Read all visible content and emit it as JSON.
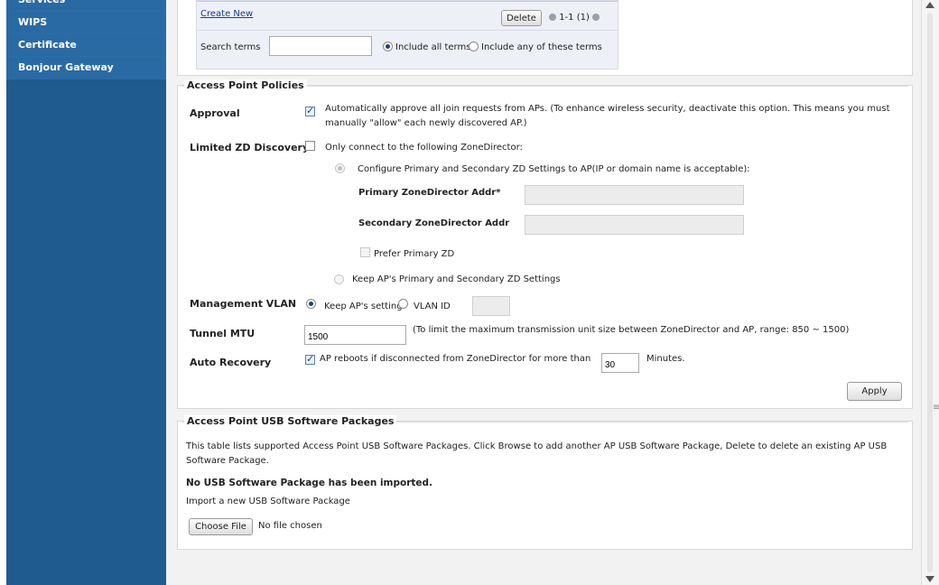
{
  "sidebar": {
    "items": [
      {
        "label": "Services"
      },
      {
        "label": "WIPS"
      },
      {
        "label": "Certificate"
      },
      {
        "label": "Bonjour Gateway"
      }
    ]
  },
  "ap_list": {
    "create_new": "Create New",
    "delete_button": "Delete",
    "pagination": "1-1 (1)",
    "search_label": "Search terms",
    "search_value": "",
    "include_all": "Include all terms",
    "include_any": "Include any of these terms"
  },
  "policies": {
    "title": "Access Point Policies",
    "approval_label": "Approval",
    "approval_text_1": "Automatically approve all join requests from APs. (To enhance wireless security, deactivate this option. This means you must",
    "approval_text_2": "manually \"allow\" each newly discovered AP.)",
    "limited_label": "Limited ZD Discovery",
    "limited_text": "Only connect to the following ZoneDirector:",
    "configure_text": "Configure Primary and Secondary ZD Settings to AP(IP or domain name is acceptable):",
    "primary_label": "Primary ZoneDirector Addr*",
    "secondary_label": "Secondary ZoneDirector Addr",
    "prefer_primary": "Prefer Primary ZD",
    "keep_settings": "Keep AP's Primary and Secondary ZD Settings",
    "mgmt_vlan_label": "Management VLAN",
    "keep_ap_setting": "Keep AP's setting",
    "vlan_id": "VLAN ID",
    "tunnel_mtu_label": "Tunnel MTU",
    "tunnel_mtu_value": "1500",
    "tunnel_mtu_note": "(To limit the maximum transmission unit size between ZoneDirector and AP, range: 850 ~ 1500)",
    "auto_recovery_label": "Auto Recovery",
    "auto_recovery_text": "AP reboots if disconnected from ZoneDirector for more than",
    "auto_recovery_value": "30",
    "minutes": "Minutes.",
    "apply": "Apply"
  },
  "usb": {
    "title": "Access Point USB Software Packages",
    "desc_1": "This table lists supported Access Point USB Software Packages. Click Browse to add another AP USB Software Package, Delete to delete an existing AP USB",
    "desc_2": "Software Package.",
    "none_imported": "No USB Software Package has been imported.",
    "import_label": "Import a new USB Software Package",
    "choose_file": "Choose File",
    "no_file": "No file chosen"
  },
  "colors": {
    "sidebar": "#1f5b8e",
    "link": "#1b3d8f"
  }
}
